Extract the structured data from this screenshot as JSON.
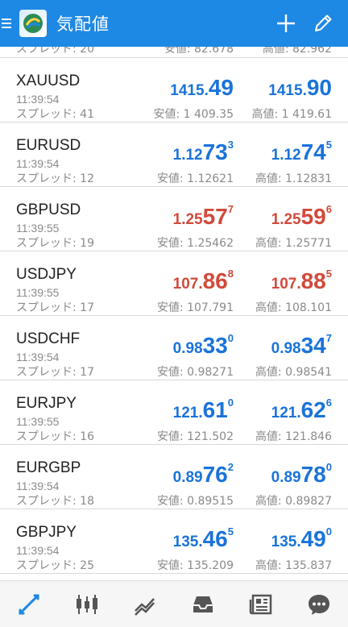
{
  "header": {
    "title": "気配値"
  },
  "partial_row": {
    "spread": "スプレッド: 20",
    "low": "安値: 82.678",
    "high": "高値: 82.962"
  },
  "quotes": [
    {
      "symbol": "XAUUSD",
      "time": "11:39:54",
      "spread": "スプレッド: 41",
      "color": "#1a73d9",
      "bid": {
        "small": "1415.",
        "big": "49",
        "sup": ""
      },
      "ask": {
        "small": "1415.",
        "big": "90",
        "sup": ""
      },
      "low": "安値: 1 409.35",
      "high": "高値: 1 419.61"
    },
    {
      "symbol": "EURUSD",
      "time": "11:39:54",
      "spread": "スプレッド: 12",
      "color": "#1a73d9",
      "bid": {
        "small": "1.12",
        "big": "73",
        "sup": "3"
      },
      "ask": {
        "small": "1.12",
        "big": "74",
        "sup": "5"
      },
      "low": "安値: 1.12621",
      "high": "高値: 1.12831"
    },
    {
      "symbol": "GBPUSD",
      "time": "11:39:55",
      "spread": "スプレッド: 19",
      "color": "#d14a3b",
      "bid": {
        "small": "1.25",
        "big": "57",
        "sup": "7"
      },
      "ask": {
        "small": "1.25",
        "big": "59",
        "sup": "6"
      },
      "low": "安値: 1.25462",
      "high": "高値: 1.25771"
    },
    {
      "symbol": "USDJPY",
      "time": "11:39:55",
      "spread": "スプレッド: 17",
      "color": "#d14a3b",
      "bid": {
        "small": "107.",
        "big": "86",
        "sup": "8"
      },
      "ask": {
        "small": "107.",
        "big": "88",
        "sup": "5"
      },
      "low": "安値: 107.791",
      "high": "高値: 108.101"
    },
    {
      "symbol": "USDCHF",
      "time": "11:39:54",
      "spread": "スプレッド: 17",
      "color": "#1a73d9",
      "bid": {
        "small": "0.98",
        "big": "33",
        "sup": "0"
      },
      "ask": {
        "small": "0.98",
        "big": "34",
        "sup": "7"
      },
      "low": "安値: 0.98271",
      "high": "高値: 0.98541"
    },
    {
      "symbol": "EURJPY",
      "time": "11:39:55",
      "spread": "スプレッド: 16",
      "color": "#1a73d9",
      "bid": {
        "small": "121.",
        "big": "61",
        "sup": "0"
      },
      "ask": {
        "small": "121.",
        "big": "62",
        "sup": "6"
      },
      "low": "安値: 121.502",
      "high": "高値: 121.846"
    },
    {
      "symbol": "EURGBP",
      "time": "11:39:54",
      "spread": "スプレッド: 18",
      "color": "#1a73d9",
      "bid": {
        "small": "0.89",
        "big": "76",
        "sup": "2"
      },
      "ask": {
        "small": "0.89",
        "big": "78",
        "sup": "0"
      },
      "low": "安値: 0.89515",
      "high": "高値: 0.89827"
    },
    {
      "symbol": "GBPJPY",
      "time": "11:39:54",
      "spread": "スプレッド: 25",
      "color": "#1a73d9",
      "bid": {
        "small": "135.",
        "big": "46",
        "sup": "5"
      },
      "ask": {
        "small": "135.",
        "big": "49",
        "sup": "0"
      },
      "low": "安値: 135.209",
      "high": "高値: 135.837"
    }
  ],
  "icons": {
    "menu": "menu-icon",
    "logo": "metatrader-logo",
    "add": "plus-icon",
    "edit": "pencil-icon",
    "nav": [
      "quotes-icon",
      "chart-candles-icon",
      "trade-icon",
      "history-inbox-icon",
      "news-icon",
      "chat-icon"
    ]
  },
  "colors": {
    "accent": "#1e88e5",
    "price_up": "#1a73d9",
    "price_down": "#d14a3b",
    "nav_active": "#1e88e5",
    "nav_inactive": "#555555"
  }
}
